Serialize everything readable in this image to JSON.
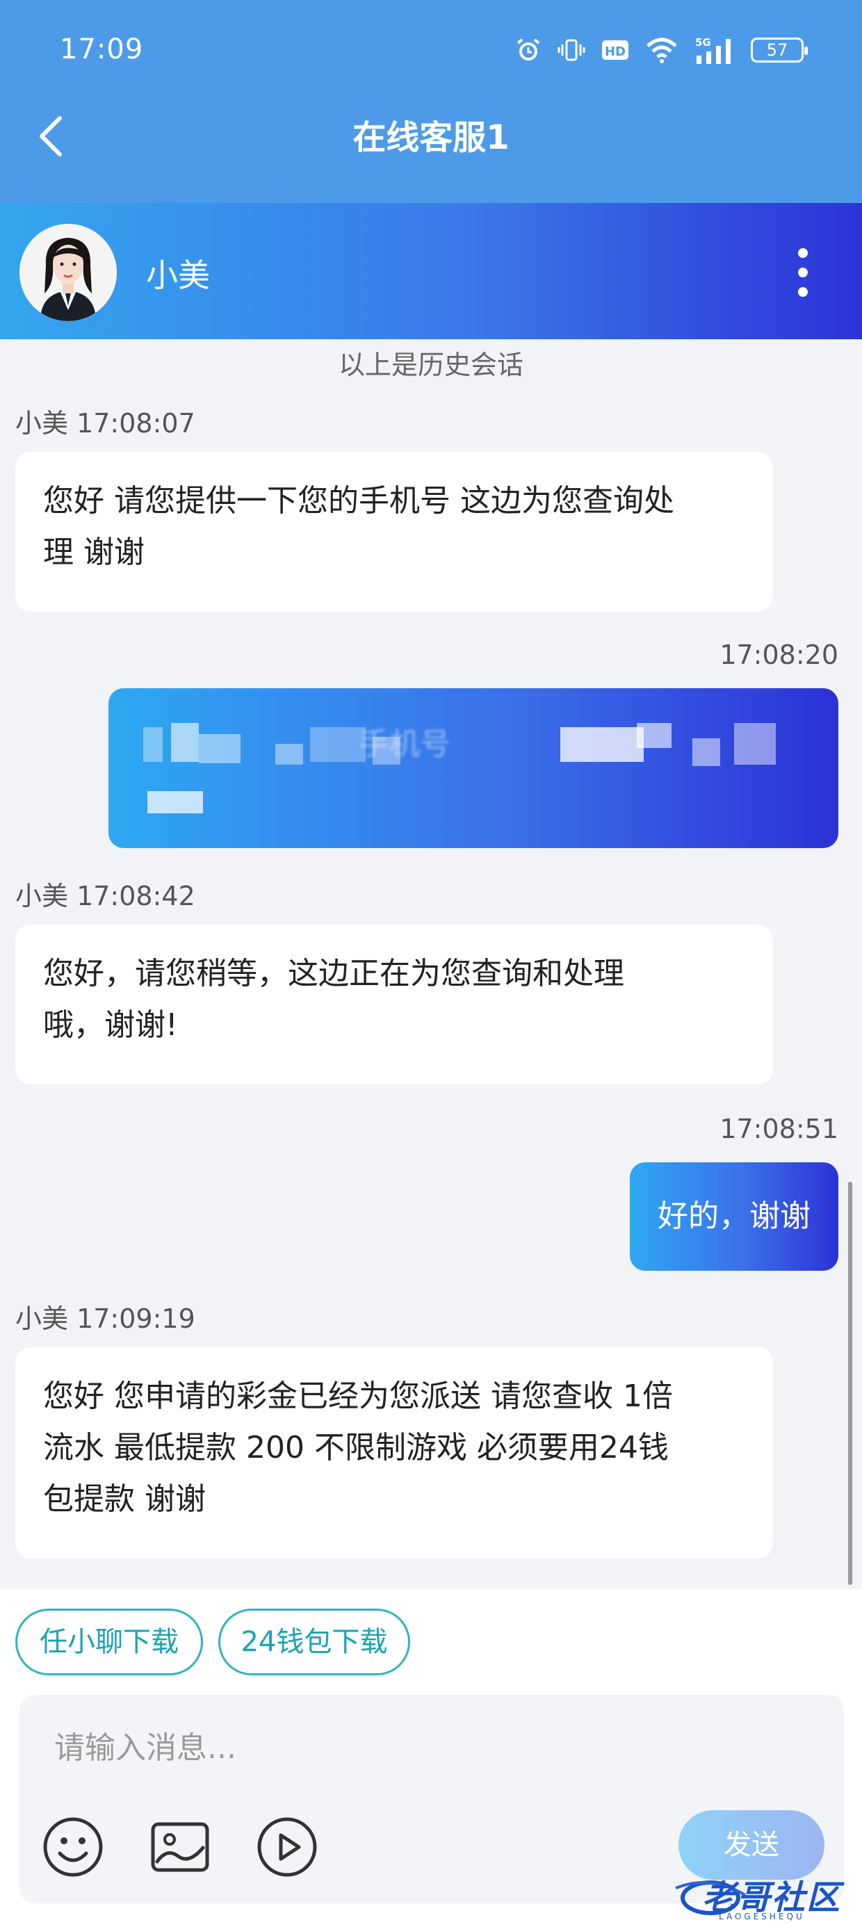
{
  "status_bar": {
    "time": "17:09",
    "battery": "57",
    "network": "5G",
    "hd": "HD"
  },
  "header": {
    "title": "在线客服1"
  },
  "agent": {
    "name": "小美"
  },
  "history_note": "以上是历史会话",
  "messages": [
    {
      "sender": "小美",
      "time": "17:08:07",
      "meta": "小美 17:08:07",
      "text_lines": [
        "您好 请您提供一下您的手机号 这边为您查询处",
        "理 谢谢"
      ]
    },
    {
      "sender": "user",
      "time": "17:08:20",
      "text": "手机号"
    },
    {
      "sender": "小美",
      "time": "17:08:42",
      "meta": "小美 17:08:42",
      "text_lines": [
        "您好，请您稍等，这边正在为您查询和处理",
        "哦，谢谢!"
      ]
    },
    {
      "sender": "user",
      "time": "17:08:51",
      "text": "好的，谢谢"
    },
    {
      "sender": "小美",
      "time": "17:09:19",
      "meta": "小美 17:09:19",
      "text_lines": [
        "您好 您申请的彩金已经为您派送 请您查收 1倍",
        "流水 最低提款 200  不限制游戏  必须要用24钱",
        "包提款 谢谢"
      ]
    }
  ],
  "quick_actions": [
    "任小聊下载",
    "24钱包下载"
  ],
  "composer": {
    "placeholder": "请输入消息...",
    "send_label": "发送"
  },
  "watermark": {
    "text": "老哥社区",
    "sub": "LAOGESHEQU"
  },
  "colors": {
    "header": "#4d9be8",
    "quick_border": "#2fb3be",
    "bubble_user_start": "#2ea8f2",
    "bubble_user_end": "#2b32d7"
  }
}
